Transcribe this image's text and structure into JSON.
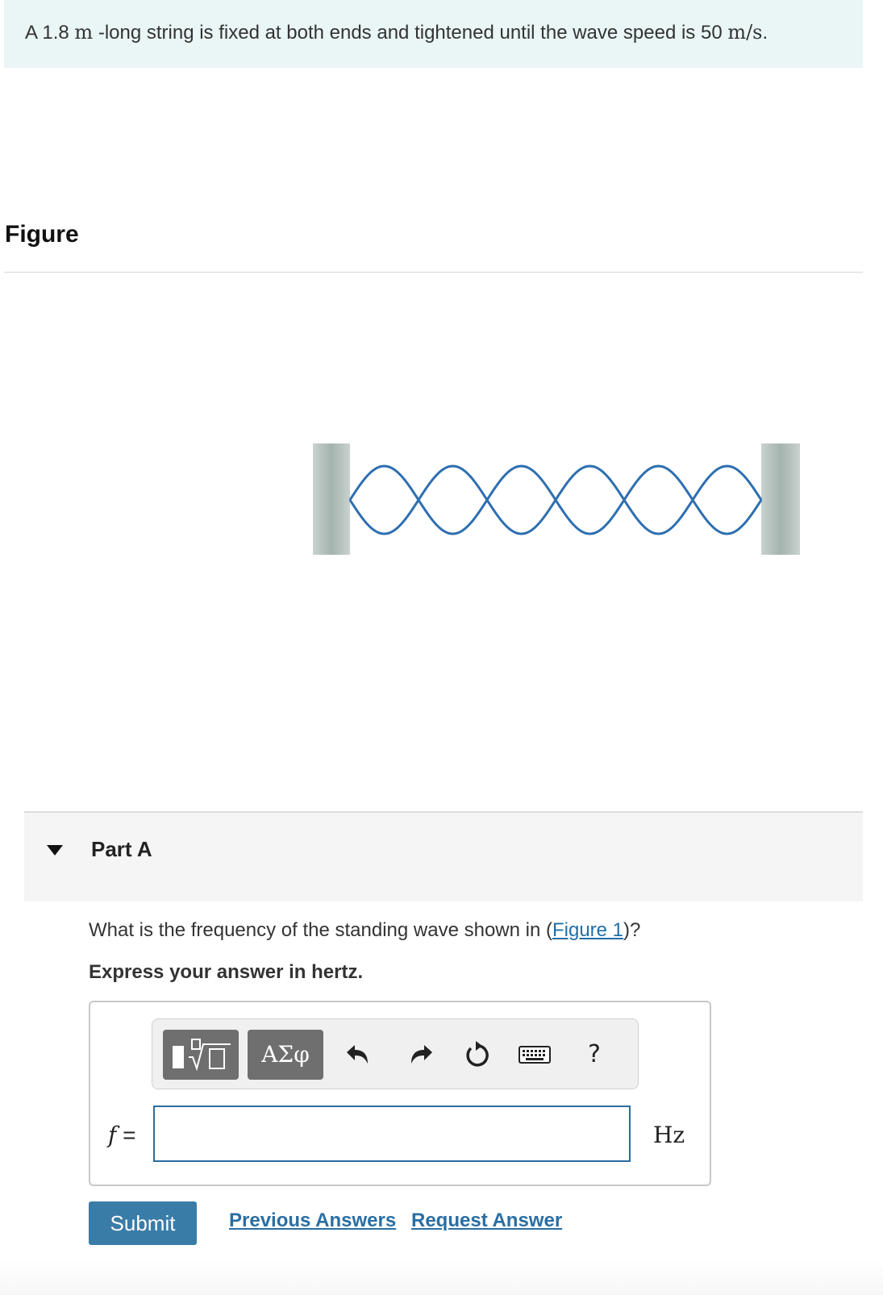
{
  "problem": {
    "text_before": "A 1.8 ",
    "unit_length": "m",
    "text_middle": " -long string is fixed at both ends and tightened until the wave speed is 50 ",
    "unit_speed": "m/s",
    "text_end": "."
  },
  "figure_section": {
    "heading": "Figure"
  },
  "figure": {
    "wave_color": "#2e6fb0",
    "wall_color": "#a9b7b3",
    "half_loops": 6
  },
  "part": {
    "title": "Part A",
    "question_before": "What is the frequency of the standing wave shown in (",
    "figure_link": "Figure 1",
    "question_after": ")?",
    "instruction": "Express your answer in hertz."
  },
  "answer": {
    "toolbar": {
      "templates_icon": "templates-sqrt-icon",
      "greek_label": "ΑΣφ",
      "undo_icon": "undo-icon",
      "redo_icon": "redo-icon",
      "reset_icon": "reset-icon",
      "keyboard_icon": "keyboard-icon",
      "help_label": "?"
    },
    "variable": "f",
    "equals": "=",
    "value": "",
    "unit": "Hz"
  },
  "actions": {
    "submit_label": "Submit",
    "previous_answers_label": "Previous Answers",
    "request_answer_label": "Request Answer"
  }
}
